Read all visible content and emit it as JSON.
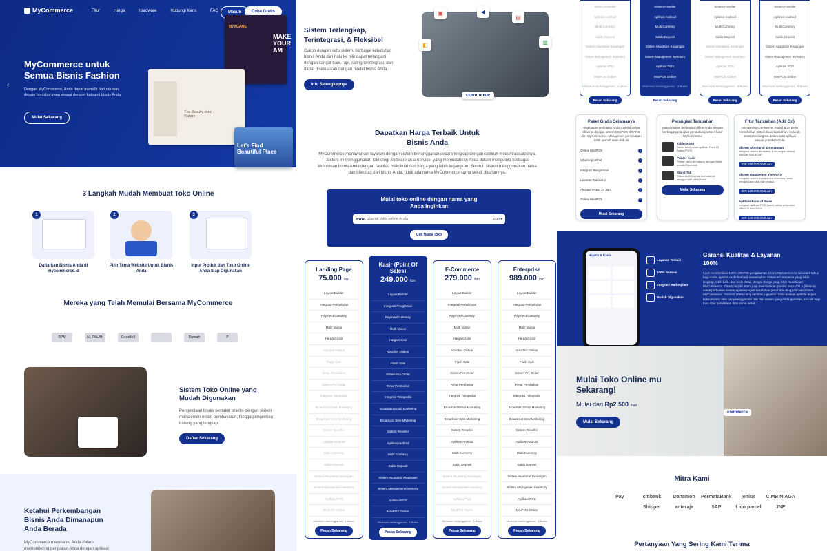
{
  "brand": "MyCommerce",
  "nav": {
    "items": [
      "Fitur",
      "Harga",
      "Hardware",
      "Hubungi Kami",
      "FAQ"
    ],
    "login": "Masuk",
    "trial": "Coba Gratis"
  },
  "hero": {
    "title_l1": "MyCommerce untuk",
    "title_l2": "Semua Bisnis Fashion",
    "desc": "Dengan MyCommerce, Anda dapat memilih dari ratusan desain tampilan yang sesuai dengan kategori bisnis Anda",
    "cta": "Mulai Sekarang",
    "mock_a": "MYXGAME",
    "mock_b": "MAKE YOUR AM",
    "mock_c": "The Beauty from Nature",
    "mock_d": "Let's Find Beautiful Place"
  },
  "steps": {
    "title": "3 Langkah Mudah Membuat Toko Online",
    "items": [
      {
        "num": "1",
        "label": "Daftarkan Bisnis Anda di mycommerce.id"
      },
      {
        "num": "2",
        "label": "Pilih Tema Website Untuk Bisnis Anda"
      },
      {
        "num": "3",
        "label": "Input Produk dan Toko Online Anda Siap Digunakan"
      }
    ]
  },
  "clients": {
    "title": "Mereka yang Telah Memulai Bersama MyCommerce",
    "logos": [
      "RPM",
      "AL FALAH",
      "Goodfull",
      "",
      "Rumah",
      "P"
    ]
  },
  "easy": {
    "title": "Sistem Toko Online yang Mudah Digunakan",
    "desc": "Pengelolaan bisnis semakin praktis dengan sistem manajemen order, pembayaran, hingga pengiriman barang yang lengkap.",
    "cta": "Daftar Sekarang"
  },
  "growth": {
    "title": "Ketahui Perkembangan Bisnis Anda Dimanapun Anda Berada",
    "desc": "MyCommerce membantu Anda dalam memonitoring penjualan Anda dengan aplikasi"
  },
  "complete": {
    "title_l1": "Sistem Terlengkap,",
    "title_l2": "Terintegrasi, & Fleksibel",
    "desc": "Cukup dengan satu sistem, berbagai kebutuhan bisnis Anda dari hulu ke hilir dapat terlangani dengan sangat baik, rapi, saling terintegrasi, dan dapat disesuaikan dengan model bisnis Anda.",
    "cta": "Info Selengkapnya",
    "logo": "commerce"
  },
  "bestprice": {
    "title_l1": "Dapatkan Harga Terbaik Untuk",
    "title_l2": "Bisnis Anda",
    "desc": "MyCommerce menawarkan layanan dengan sistem berlangganan secara lengkap dengan seluruh modul transaksinya. Sistem ini menggunakan teknologi Software as a Service, yang memudahkan Anda dalam mengelola berbagai kebutuhan bisnis Anda dengan fasilitas maksimal dan harga yang lebih terjangkau. Seluruh sistem menggunakan nama dan identitas dari bisnis Anda, tidak ada nama MyCommerce sama sekali didalamnya."
  },
  "domain": {
    "title_l1": "Mulai toko online dengan nama yang",
    "title_l2": "Anda inginkan",
    "prefix": "www.",
    "placeholder": "alamat toko online Anda",
    "suffix": ".com",
    "cta": "Cek Nama Toko"
  },
  "pricing": [
    {
      "name_l1": "Landing Page",
      "name_l2": "",
      "price": "75.000",
      "per": "/bln",
      "featured": false,
      "min": "Minimum berlangganan : 1 tahun",
      "cta": "Pesan Sekarang",
      "features": [
        [
          "Layout Builder",
          1
        ],
        [
          "Integrasi Pengiriman",
          1
        ],
        [
          "Payment Gateway",
          1
        ],
        [
          "Multi Varian",
          1
        ],
        [
          "Harga Grosir",
          1
        ],
        [
          "Voucher Diskon",
          0
        ],
        [
          "Flash Sale",
          0
        ],
        [
          "Retur Pembelian",
          0
        ],
        [
          "Sistem Pre Order",
          0
        ],
        [
          "Integrasi Tokopedia",
          0
        ],
        [
          "Broadcast Email Marketing",
          0
        ],
        [
          "Broadcast Sms Marketing",
          0
        ],
        [
          "Sistem Reseller",
          0
        ],
        [
          "Aplikasi Android",
          0
        ],
        [
          "Multi Currency",
          0
        ],
        [
          "Saldo Deposit",
          0
        ],
        [
          "Sistem Akuntansi Keuangan",
          0
        ],
        [
          "Sistem Manajemen Inventory",
          0
        ],
        [
          "Aplikasi POS",
          0
        ],
        [
          "MiniPOS Online",
          0
        ]
      ]
    },
    {
      "name_l1": "Kasir (Point Of",
      "name_l2": "Sales)",
      "price": "249.000",
      "per": "/bln",
      "featured": true,
      "min": "Minimum berlangganan : 3 Bulan",
      "cta": "Pesan Sekarang",
      "features": [
        [
          "Layout Builder",
          1
        ],
        [
          "Integrasi Pengiriman",
          1
        ],
        [
          "Payment Gateway",
          1
        ],
        [
          "Multi Varian",
          1
        ],
        [
          "Harga Grosir",
          1
        ],
        [
          "Voucher Diskon",
          1
        ],
        [
          "Flash Sale",
          1
        ],
        [
          "Sistem Pre Order",
          1
        ],
        [
          "Retur Pembelian",
          1
        ],
        [
          "Integrasi Tokopedia",
          1
        ],
        [
          "Broadcast Email Marketing",
          1
        ],
        [
          "Broadcast Sms Marketing",
          1
        ],
        [
          "Sistem Reseller",
          1
        ],
        [
          "Aplikasi Android",
          1
        ],
        [
          "Multi Currency",
          1
        ],
        [
          "Saldo Deposit",
          1
        ],
        [
          "Sistem Akuntansi Keuangan",
          1
        ],
        [
          "Sistem Manajemen Inventory",
          1
        ],
        [
          "Aplikasi POS",
          1
        ],
        [
          "MiniPOS Online",
          1
        ]
      ]
    },
    {
      "name_l1": "E-Commerce",
      "name_l2": "",
      "price": "279.000",
      "per": "/bln",
      "featured": false,
      "min": "Minimum berlangganan : 3 Bulan",
      "cta": "Pesan Sekarang",
      "features": [
        [
          "Layout Builder",
          1
        ],
        [
          "Integrasi Pengiriman",
          1
        ],
        [
          "Payment Gateway",
          1
        ],
        [
          "Multi Varian",
          1
        ],
        [
          "Harga Grosir",
          1
        ],
        [
          "Voucher Diskon",
          1
        ],
        [
          "Flash Sale",
          1
        ],
        [
          "Sistem Pre Order",
          1
        ],
        [
          "Retur Pembelian",
          1
        ],
        [
          "Integrasi Tokopedia",
          1
        ],
        [
          "Broadcast Email Marketing",
          1
        ],
        [
          "Broadcast Sms Marketing",
          1
        ],
        [
          "Sistem Reseller",
          1
        ],
        [
          "Aplikasi Android",
          1
        ],
        [
          "Multi Currency",
          1
        ],
        [
          "Saldo Deposit",
          1
        ],
        [
          "Sistem Akuntansi Keuangan",
          0
        ],
        [
          "Sistem Manajemen Inventory",
          0
        ],
        [
          "Aplikasi POS",
          0
        ],
        [
          "MiniPOS Online",
          0
        ]
      ]
    },
    {
      "name_l1": "Enterprise",
      "name_l2": "",
      "price": "989.000",
      "per": "/bln",
      "featured": false,
      "min": "Minimum berlangganan : 3 Bulan",
      "cta": "Pesan Sekarang",
      "features": [
        [
          "Layout Builder",
          1
        ],
        [
          "Integrasi Pengiriman",
          1
        ],
        [
          "Payment Gateway",
          1
        ],
        [
          "Multi Varian",
          1
        ],
        [
          "Harga Grosir",
          1
        ],
        [
          "Voucher Diskon",
          1
        ],
        [
          "Flash Sale",
          1
        ],
        [
          "Sistem Pre Order",
          1
        ],
        [
          "Retur Pembelian",
          1
        ],
        [
          "Integrasi Tokopedia",
          1
        ],
        [
          "Broadcast Email Marketing",
          1
        ],
        [
          "Broadcast Sms Marketing",
          1
        ],
        [
          "Sistem Reseller",
          1
        ],
        [
          "Aplikasi Android",
          1
        ],
        [
          "Multi Currency",
          1
        ],
        [
          "Saldo Deposit",
          1
        ],
        [
          "Sistem Akuntansi Keuangan",
          1
        ],
        [
          "Sistem Manajemen Inventory",
          1
        ],
        [
          "Aplikasi POS",
          1
        ],
        [
          "MiniPOS Online",
          1
        ]
      ]
    }
  ],
  "pricing_tail": [
    {
      "featured": false,
      "features": [
        [
          "Sistem Reseller",
          0
        ],
        [
          "Aplikasi Android",
          0
        ],
        [
          "Multi Currency",
          0
        ],
        [
          "Saldo Deposit",
          0
        ],
        [
          "Sistem Akuntansi Keuangan",
          0
        ],
        [
          "Sistem Manajemen Inventory",
          0
        ],
        [
          "Aplikasi POS",
          0
        ],
        [
          "MiniPOS Online",
          0
        ],
        [
          "Minimum berlangganan : 1 tahun",
          0
        ]
      ],
      "cta": "Pesan Sekarang"
    },
    {
      "featured": true,
      "features": [
        [
          "Sistem Reseller",
          1
        ],
        [
          "Aplikasi Android",
          1
        ],
        [
          "Multi Currency",
          1
        ],
        [
          "Saldo Deposit",
          1
        ],
        [
          "Sistem Akuntansi Keuangan",
          1
        ],
        [
          "Sistem Manajemen Inventory",
          1
        ],
        [
          "Aplikasi POS",
          1
        ],
        [
          "MiniPOS Online",
          1
        ],
        [
          "Minimum berlangganan : 3 Bulan",
          0
        ]
      ],
      "cta": "Pesan Sekarang"
    },
    {
      "featured": false,
      "features": [
        [
          "Sistem Reseller",
          1
        ],
        [
          "Aplikasi Android",
          1
        ],
        [
          "Multi Currency",
          1
        ],
        [
          "Saldo Deposit",
          1
        ],
        [
          "Sistem Akuntansi Keuangan",
          0
        ],
        [
          "Sistem Manajemen Inventory",
          0
        ],
        [
          "Aplikasi POS",
          0
        ],
        [
          "MiniPOS Online",
          0
        ],
        [
          "Minimum berlangganan : 3 Bulan",
          0
        ]
      ],
      "cta": "Pesan Sekarang"
    },
    {
      "featured": false,
      "features": [
        [
          "Sistem Reseller",
          1
        ],
        [
          "Aplikasi Android",
          1
        ],
        [
          "Multi Currency",
          1
        ],
        [
          "Saldo Deposit",
          1
        ],
        [
          "Sistem Akuntansi Keuangan",
          1
        ],
        [
          "Sistem Manajemen Inventory",
          1
        ],
        [
          "Aplikasi POS",
          1
        ],
        [
          "MiniPOS Online",
          1
        ],
        [
          "Minimum berlangganan : 3 Bulan",
          0
        ]
      ],
      "cta": "Pesan Sekarang"
    }
  ],
  "addons": {
    "free": {
      "title": "Paket Gratis Selamanya",
      "desc": "Tingkatkan penjualan Anda melalui online channel dengan sistem MiniPOS GRATIS dari MyCommerce. Manajemen pemesanan tidak pernah semudah ini",
      "items": [
        "Online MiniPOS",
        "WhatsApp Chat",
        "Integrasi Pengiriman",
        "Laporan Transaksi",
        "Aktivasi Instan 24 Jam",
        "Online MiniPOS"
      ],
      "cta": "Mulai Sekarang"
    },
    "hardware": {
      "title": "Perangkat Tambahan",
      "desc": "Maksimalkan penjualan offline Anda dengan berbagai perangkat pendukung sistem kasir MyCommerce",
      "items": [
        {
          "name": "Tablet Kasir",
          "desc": "Tablet kasir untuk aplikasi Point Of Sales (POS)"
        },
        {
          "name": "Printer Kasir",
          "desc": "Printer yang terhubung dengan tablet melalui bluetooth"
        },
        {
          "name": "Stand Tab",
          "desc": "Stand aktifkit untuk kemudahan penggunaan tablet kasir"
        }
      ],
      "cta": "Mulai Sekarang"
    },
    "extra": {
      "title": "Fitur Tambahan (Add On)",
      "desc": "Dengan MyCommerce, Anda harus perlu memikirkan sistem kasir tambahan. Seluruh sistem terintegrasi dalam satu aplikasi sesuai gunakan Anda",
      "items": [
        {
          "name": "Sistem Akuntansi & Keuangan",
          "desc": "Integrasi sistem akuntansi & keuangan sesuai standar SAK ETAP",
          "price": "IDR 299.000,00/bulan"
        },
        {
          "name": "Sistem Manajemen Inventory",
          "desc": "Integrasi sistem manajemen inventory untuk pengelolaan stok dan produk",
          "price": "IDR 129.000,00/bulan"
        },
        {
          "name": "Aplikasi Point of Sales",
          "desc": "Integrasi aplikasi POS (kasir) untuk penjualan offline di toko Anda",
          "price": "IDR 249.000,00/bulan"
        }
      ]
    }
  },
  "guarantee": {
    "title_l1": "Garansi Kualitas & Layanan",
    "title_l2": "100%",
    "desc": "Kami memberikan 100% GRATIS pengalaman sistem MyCommerce selama 1 tahun bagi Anda, apabila Anda berhasil menemukan Sistem eCommerce yang lebih lengkap, lebih baik, dan lebih detail, dengan harga yang lebih murah dari MyCommerce. Disamping itu, kami juga memberikan garansi sesuai SLA (lifetime) untuk perbaikan sistem apabila terjadi kesalahan (error atau bug) dan ide sistem MyCommerce. Garansi 100% uang kembali juga akan kami berikan apabila terjadi kekecewaan atau penyelenggaraan dan dari sistem yang Anda gunakan, kecuali bagi toko atau pemilikaan data sama sekali.",
    "badges": [
      "Layanan Terbaik",
      "100% Garansi",
      "Integrasi Marketplace",
      "Mudah Digunakan"
    ],
    "phone_title": "Hajarta & Kania"
  },
  "start": {
    "title_l1": "Mulai Toko Online mu",
    "title_l2": "Sekarang!",
    "price_prefix": "Mulai dari",
    "price": "Rp2.500",
    "per": "/hari",
    "cta": "Mulai Sekarang",
    "logo": "commerce"
  },
  "partners": {
    "title": "Mitra Kami",
    "items": [
      "Pay",
      "citibank",
      "Danamon",
      "PermataBank",
      "jenius",
      "CIMB NIAGA",
      "",
      "Shipper",
      "anteraja",
      "SAP",
      "Lion parcel",
      "JNE"
    ]
  },
  "faq": {
    "title": "Pertanyaan Yang Sering Kami Terima"
  },
  "colors": {
    "navy": "#14318f"
  }
}
